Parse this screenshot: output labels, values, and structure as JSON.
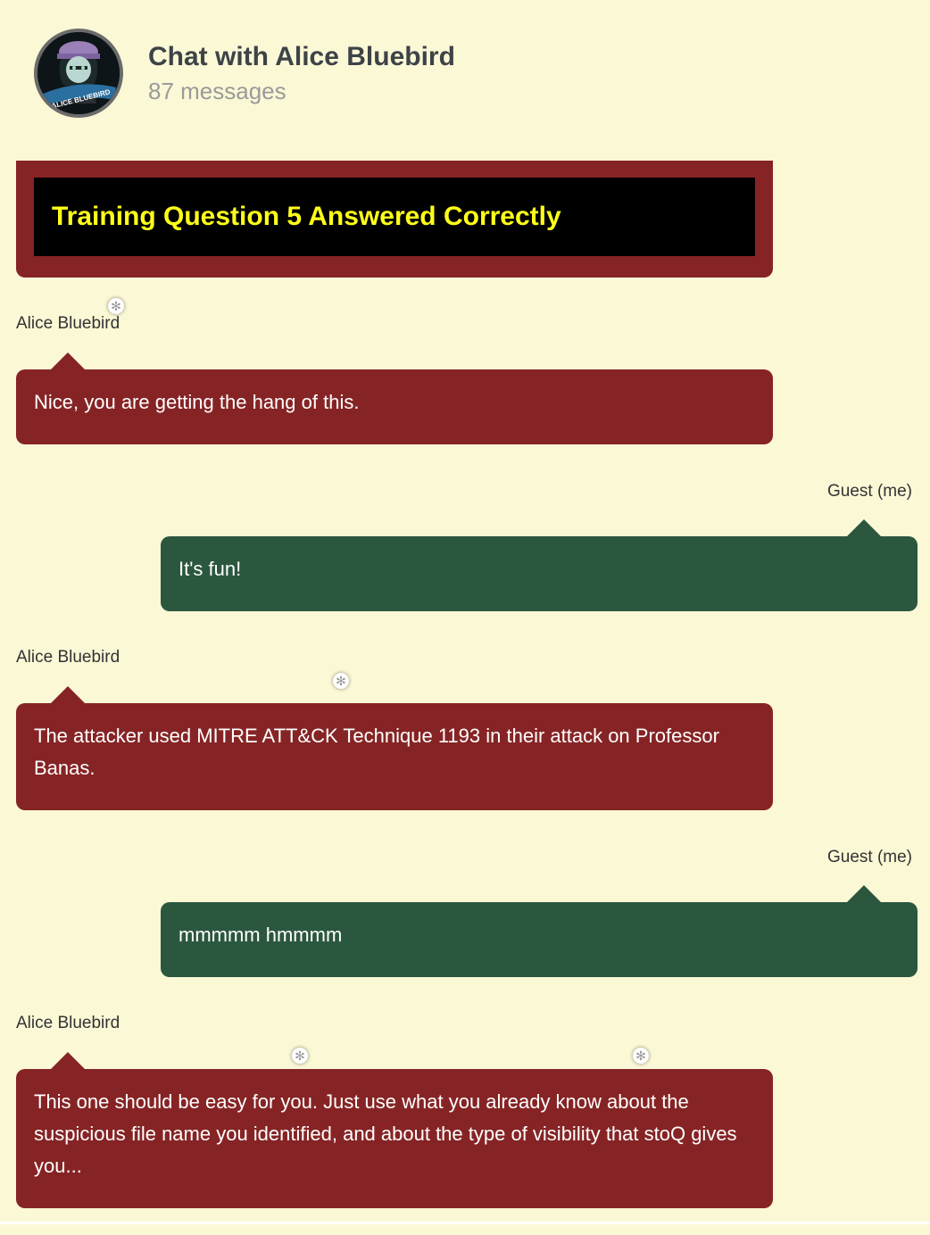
{
  "header": {
    "title": "Chat with Alice Bluebird",
    "message_count": "87 messages",
    "avatar_banner_text": "ALICE BLUEBIRD"
  },
  "announcement": {
    "text": "Training Question 5 Answered Correctly",
    "background": "#862425",
    "text_color": "#ffff1a"
  },
  "messages": [
    {
      "sender": "Alice Bluebird",
      "side": "left",
      "text": "Nice, you are getting the hang of this."
    },
    {
      "sender": "Guest (me)",
      "side": "right",
      "text": "It's fun!"
    },
    {
      "sender": "Alice Bluebird",
      "side": "left",
      "text": "The attacker used MITRE ATT&CK Technique 1193 in their attack on Professor Banas."
    },
    {
      "sender": "Guest (me)",
      "side": "right",
      "text": "mmmmm hmmmm"
    },
    {
      "sender": "Alice Bluebird",
      "side": "left",
      "text": "This one should be easy for you. Just use what you already know about the suspicious file name you identified, and about the type of visibility that stoQ gives you..."
    }
  ],
  "colors": {
    "page_background": "#fbf8d6",
    "alice_bubble": "#862425",
    "guest_bubble": "#2b573f"
  },
  "decorations": {
    "snowflake_icon": "snowflake-icon"
  }
}
